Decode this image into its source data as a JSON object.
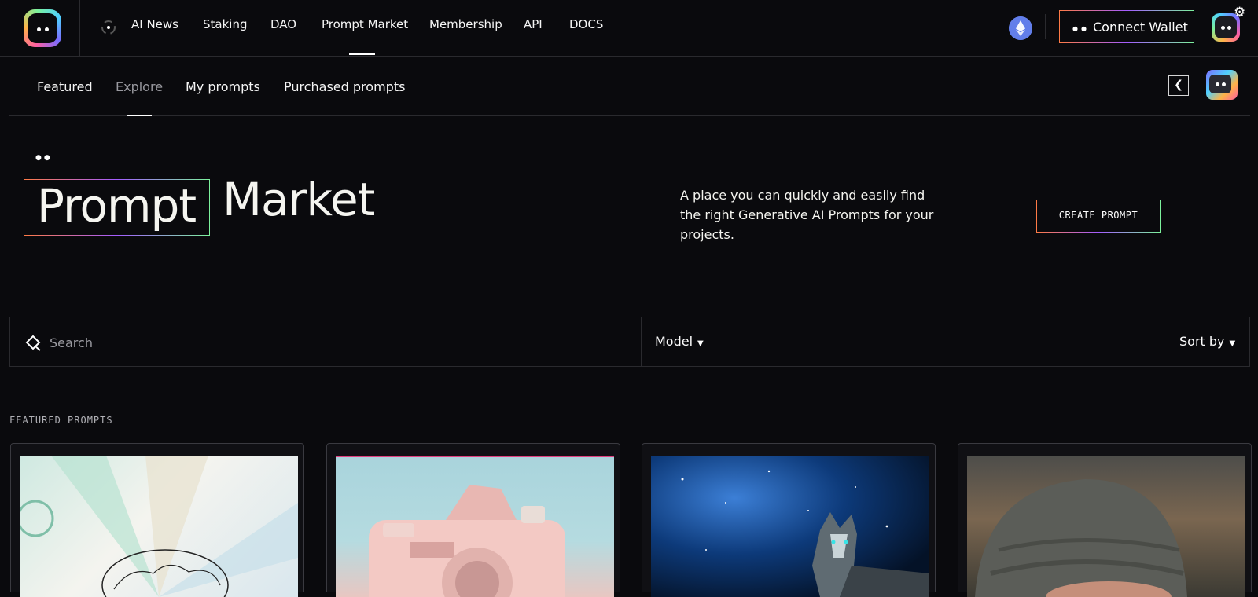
{
  "nav": {
    "items": [
      {
        "label": "AI News"
      },
      {
        "label": "Staking"
      },
      {
        "label": "DAO"
      },
      {
        "label": "Prompt Market"
      },
      {
        "label": "Membership"
      },
      {
        "label": "API"
      },
      {
        "label": "DOCS"
      }
    ],
    "active": "Prompt Market",
    "connect_wallet_label": "Connect Wallet"
  },
  "subnav": {
    "tabs": [
      {
        "label": "Featured"
      },
      {
        "label": "Explore"
      },
      {
        "label": "My prompts"
      },
      {
        "label": "Purchased prompts"
      }
    ],
    "active": "Explore"
  },
  "hero": {
    "title_boxed": "Prompt",
    "title_rest": "Market",
    "description": "A place you can quickly and easily find the right Generative AI Prompts for your projects.",
    "create_button_label": "CREATE PROMPT"
  },
  "filters": {
    "search_placeholder": "Search",
    "model_label": "Model",
    "sort_label": "Sort by"
  },
  "featured": {
    "section_title": "FEATURED PROMPTS",
    "cards": [
      {
        "image": "brain-sketch-image"
      },
      {
        "image": "pastel-camera-image"
      },
      {
        "image": "wolf-galaxy-image"
      },
      {
        "image": "beanie-portrait-image"
      }
    ]
  },
  "colors": {
    "background": "#0a0a0d",
    "border": "#2a2a2e",
    "gradient": [
      "#ff7a45",
      "#a35cff",
      "#7cf29c"
    ],
    "ethereum": "#627eea"
  },
  "icons": [
    "logo-icon",
    "loading-spinner-icon",
    "ethereum-icon",
    "avatar-icon",
    "gear-icon",
    "chevron-left-icon",
    "search-icon",
    "caret-down-icon"
  ]
}
